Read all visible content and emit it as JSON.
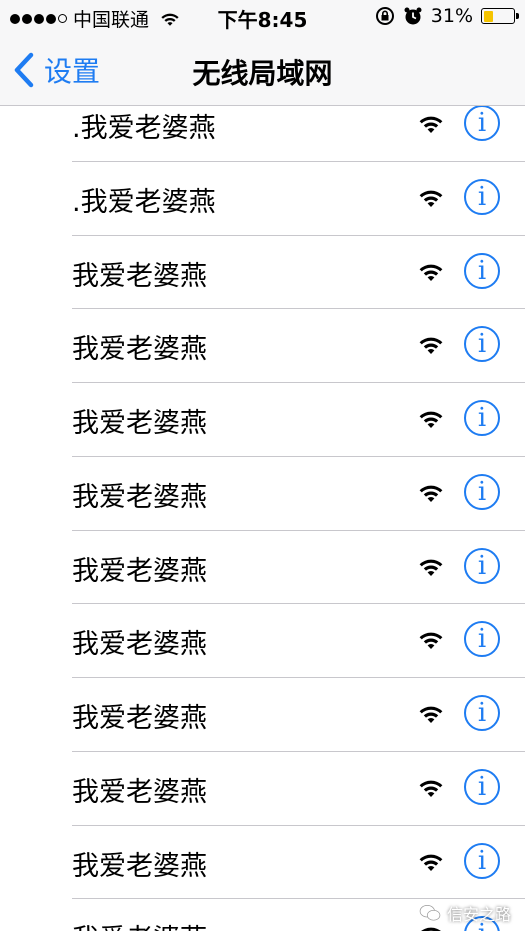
{
  "status_bar": {
    "signal_bars": 4,
    "signal_total": 5,
    "carrier": "中国联通",
    "time": "下午8:45",
    "battery_percent": "31%",
    "battery_level": 0.31,
    "battery_color": "#f5c400",
    "icons": [
      "wifi-icon",
      "rotation-lock-icon",
      "alarm-icon"
    ]
  },
  "nav": {
    "back_label": "设置",
    "title": "无线局域网",
    "accent": "#1e7cf2"
  },
  "networks": [
    {
      "name": ".我爱老婆燕"
    },
    {
      "name": ".我爱老婆燕"
    },
    {
      "name": "我爱老婆燕"
    },
    {
      "name": "我爱老婆燕"
    },
    {
      "name": "我爱老婆燕"
    },
    {
      "name": "我爱老婆燕"
    },
    {
      "name": "我爱老婆燕"
    },
    {
      "name": "我爱老婆燕"
    },
    {
      "name": "我爱老婆燕"
    },
    {
      "name": "我爱老婆燕"
    },
    {
      "name": "我爱老婆燕"
    },
    {
      "name": "我爱老婆燕"
    }
  ],
  "info_glyph": "i",
  "watermark": {
    "text": "信安之路"
  }
}
